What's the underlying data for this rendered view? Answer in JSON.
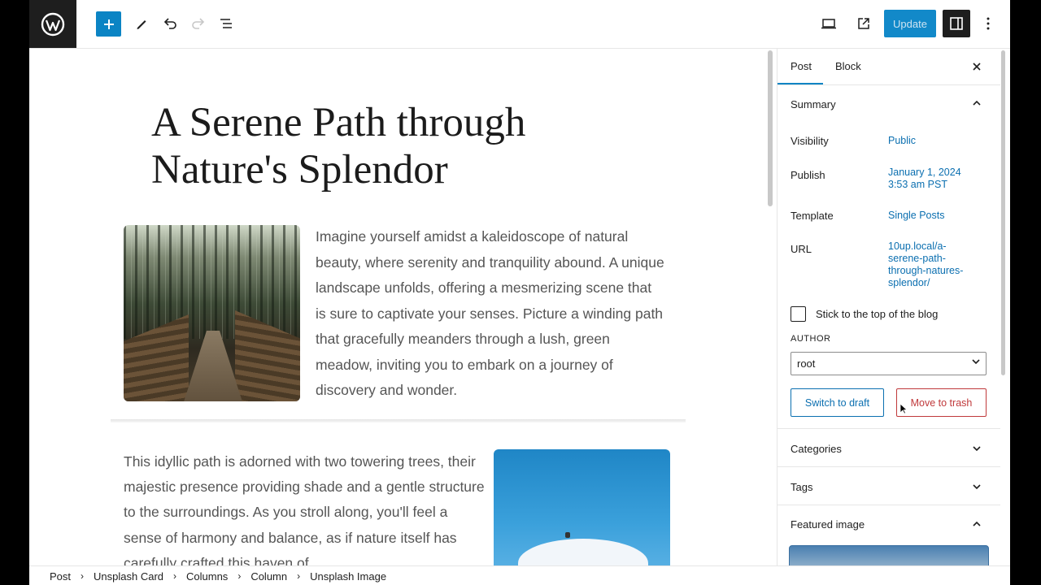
{
  "toolbar": {
    "update_label": "Update",
    "icons": [
      "wordpress-logo",
      "add-block-icon",
      "pencil-tool-icon",
      "undo-icon",
      "redo-icon",
      "list-view-icon",
      "desktop-preview-icon",
      "external-preview-icon",
      "settings-sidebar-icon",
      "more-options-icon"
    ]
  },
  "post": {
    "title": "A Serene Path through Nature's Splendor",
    "paragraph1": "Imagine yourself amidst a kaleidoscope of natural beauty, where serenity and tranquility abound. A unique landscape unfolds, offering a mesmerizing scene that is sure to captivate your senses. Picture a winding path that gracefully meanders through a lush, green meadow, inviting you to embark on a journey of discovery and wonder.",
    "paragraph2": "This idyllic path is adorned with two towering trees, their majestic presence providing shade and a gentle structure to the surroundings. As you stroll along, you'll feel a sense of harmony and balance, as if nature itself has carefully crafted this haven of"
  },
  "breadcrumb": [
    "Post",
    "Unsplash Card",
    "Columns",
    "Column",
    "Unsplash Image"
  ],
  "sidebar": {
    "tabs": [
      "Post",
      "Block"
    ],
    "summary": {
      "heading": "Summary",
      "visibility_label": "Visibility",
      "visibility_value": "Public",
      "publish_label": "Publish",
      "publish_value_line1": "January 1, 2024",
      "publish_value_line2": "3:53 am PST",
      "template_label": "Template",
      "template_value": "Single Posts",
      "url_label": "URL",
      "url_lines": [
        "10up.local/a-",
        "serene-path-",
        "through-natures-",
        "splendor/"
      ],
      "sticky_label": "Stick to the top of the blog",
      "author_label": "AUTHOR",
      "author_value": "root",
      "switch_draft_label": "Switch to draft",
      "move_trash_label": "Move to trash"
    },
    "categories_heading": "Categories",
    "tags_heading": "Tags",
    "featured_heading": "Featured image"
  },
  "colors": {
    "accent": "#0b84c4",
    "link": "#0b6fb0",
    "danger": "#c0393b",
    "dark": "#1e1e1e"
  }
}
